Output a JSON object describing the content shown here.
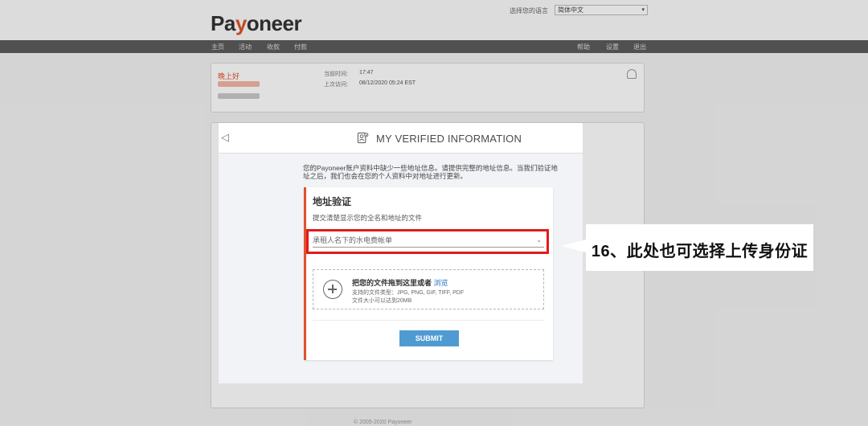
{
  "header": {
    "logo_prefix": "Pa",
    "logo_accent": "y",
    "logo_suffix": "oneer",
    "language_label": "选择您的语言",
    "language_value": "简体中文"
  },
  "nav": {
    "left": [
      "主页",
      "活动",
      "收款",
      "付款"
    ],
    "right": [
      "帮助",
      "设置",
      "退出"
    ]
  },
  "account": {
    "greeting": "晚上好",
    "current_time_label": "当前时间:",
    "current_time_value": "17:47",
    "last_login_label": "上次访问:",
    "last_login_value": "08/12/2020 05:24 EST"
  },
  "modal": {
    "back_glyph": "◁",
    "title": "MY VERIFIED INFORMATION",
    "intro": "您的Payoneer账户资料中缺少一些地址信息。请提供完整的地址信息。当我们验证地址之后，我们也会在您的个人资料中对地址进行更新。",
    "panel_title": "地址验证",
    "panel_subtitle": "提交清楚显示您的全名和地址的文件",
    "document_type": "承租人名下的水电费帐单",
    "dropzone_text": "把您的文件拖到这里或者",
    "dropzone_link": "浏览",
    "supported_types": "支持的文件类型：JPG, PNG, GIF, TIFF, PDF",
    "max_size": "文件大小可以达到20MB",
    "submit_label": "SUBMIT"
  },
  "annotation": {
    "text": "16、此处也可选择上传身份证"
  },
  "colors": {
    "accent_orange": "#e0522b",
    "annotation_red": "#e21b1b",
    "submit_blue": "#4f9bd1",
    "link_blue": "#1f72c2"
  }
}
